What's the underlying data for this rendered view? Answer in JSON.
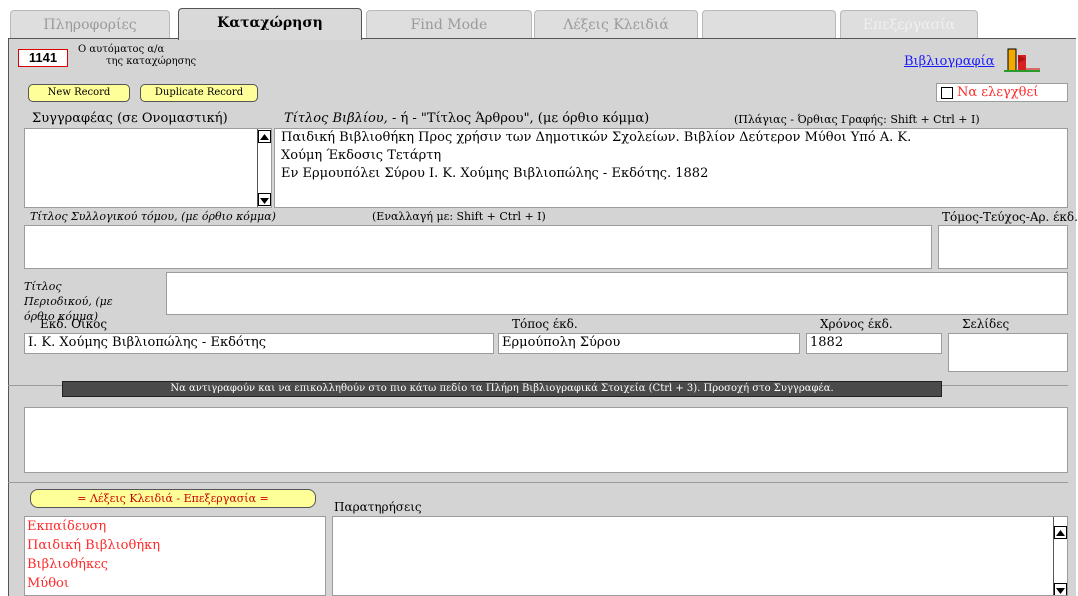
{
  "tabs": [
    {
      "label": "Πληροφορίες"
    },
    {
      "label": "Καταχώρηση"
    },
    {
      "label": "Find Mode"
    },
    {
      "label": "Λέξεις Κλειδιά"
    },
    {
      "label": ""
    },
    {
      "label": "Επεξεργασία"
    }
  ],
  "record": {
    "number": "1141",
    "auto_label_line1": "Ο αυτόματος α/α",
    "auto_label_line2": "της καταχώρησης",
    "new_record": "New Record",
    "duplicate_record": "Duplicate Record",
    "bibliography_link": "Βιβλιογραφία",
    "check_label": "Να ελεγχθεί"
  },
  "authors": {
    "label": "Συγγραφέας (σε Ονομαστική)",
    "value": ""
  },
  "title": {
    "label_main": "Τίτλος Βιβλίου,",
    "label_rest": " - ή - \"Τίτλος Άρθρου\", (με όρθιο κόμμα)",
    "hint": "(Πλάγιας - Όρθιας Γραφής: Shift + Ctrl + I)",
    "line1": "Παιδική Βιβλιοθήκη Προς χρήσιν των Δημοτικών Σχολείων. Βιβλίον Δεύτερον Μύθοι Υπό Α. Κ.",
    "line2": "Χούμη Έκδοσις Τετάρτη",
    "line3": "Εν Ερμουπόλει Σύρου Ι. Κ. Χούμης Βιβλιοπώλης - Εκδότης. 1882"
  },
  "collective": {
    "label": "Τίτλος Συλλογικού τόμου, (με όρθιο κόμμα)",
    "hint": "(Εναλλαγή με: Shift + Ctrl + I)",
    "volume_label": "Τόμος-Τεύχος-Αρ. έκδ.",
    "value": "",
    "volume_value": ""
  },
  "periodical": {
    "label_line1": "Τίτλος",
    "label_line2": "Περιοδικού, (με",
    "label_line3": "όρθιο κόμμα)",
    "value": ""
  },
  "publisher": {
    "label": "Εκδ. Οίκος",
    "value": "Ι. Κ. Χούμης Βιβλιοπώλης - Εκδότης",
    "place_label": "Τόπος έκδ.",
    "place_value": "Ερμούπολη Σύρου",
    "year_label": "Χρόνος έκδ.",
    "year_value": "1882",
    "pages_label": "Σελίδες",
    "pages_value": ""
  },
  "notice": "Να αντιγραφούν και να επικολληθούν στο πιο κάτω πεδίο τα Πλήρη Βιβλιογραφικά Στοιχεία (Ctrl + 3). Προσοχή στο Συγγραφέα.",
  "full_biblio": "",
  "keywords": {
    "button": "= Λέξεις Κλειδιά - Επεξεργασία =",
    "items": [
      "Εκπαίδευση",
      "Παιδική Βιβλιοθήκη",
      "Βιβλιοθήκες",
      "Μύθοι"
    ]
  },
  "remarks": {
    "label": "Παρατηρήσεις",
    "value": ""
  }
}
